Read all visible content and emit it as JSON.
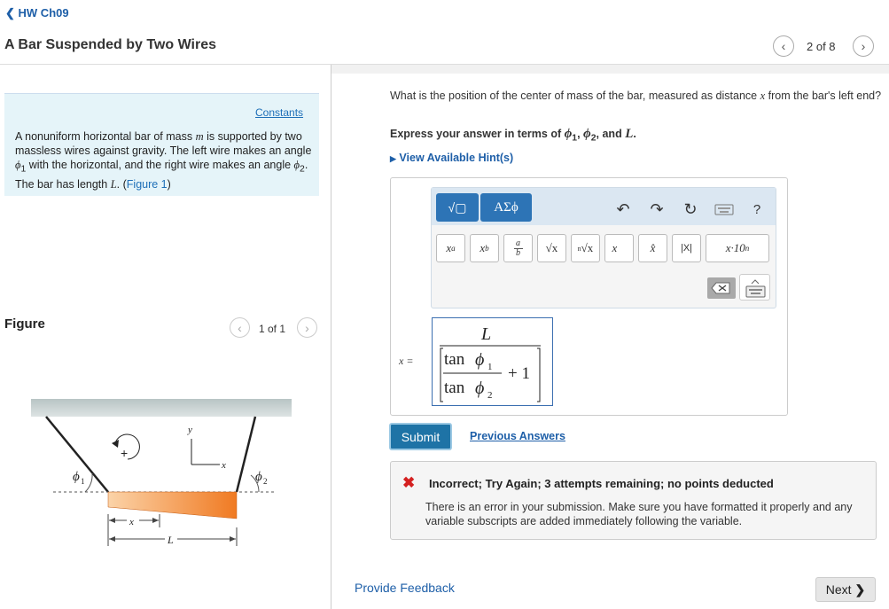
{
  "header": {
    "back_label": "HW Ch09",
    "title": "A Bar Suspended by Two Wires",
    "part_counter": "2 of 8"
  },
  "problem": {
    "constants_label": "Constants",
    "text_1": "A nonuniform horizontal bar of mass ",
    "var_m": "m",
    "text_2": " is supported by two massless wires against gravity. The left wire makes an angle ",
    "var_phi1": "ϕ",
    "sub_1": "1",
    "text_3": " with the horizontal, and the right wire makes an angle ",
    "var_phi2": "ϕ",
    "sub_2": "2",
    "text_4": ". The bar has length ",
    "var_L": "L",
    "text_5": ". (",
    "figure_link": "Figure 1",
    "text_6": ")"
  },
  "figure": {
    "heading": "Figure",
    "counter": "1 of 1",
    "labels": {
      "y": "y",
      "x_axis": "x",
      "phi1": "ϕ",
      "phi1_sub": "1",
      "phi2": "ϕ",
      "phi2_sub": "2",
      "x_dim": "x",
      "L_dim": "L",
      "rotation_sign": "+"
    }
  },
  "question": {
    "text_1": "What is the position of the center of mass of the bar, measured as distance ",
    "var_x": "x",
    "text_2": " from the bar's left end?",
    "instruction_1": "Express your answer in terms of ",
    "instruction_phi": "ϕ",
    "instruction_sub1": "1",
    "instruction_sep": ", ",
    "instruction_sub2": "2",
    "instruction_and": ", and ",
    "instruction_L": "L",
    "instruction_end": ".",
    "hints_label": "View Available Hint(s)"
  },
  "toolbar": {
    "templates_label": "√▢",
    "greek_label": "ΑΣϕ",
    "help_label": "?",
    "buttons": [
      {
        "name": "superscript-button",
        "label": "x",
        "sup": "a"
      },
      {
        "name": "subscript-button",
        "label": "x",
        "sub": "b"
      },
      {
        "name": "fraction-button",
        "num": "a",
        "den": "b"
      },
      {
        "name": "sqrt-button",
        "label": "√x"
      },
      {
        "name": "nth-root-button",
        "index": "n",
        "label": "√x"
      },
      {
        "name": "vector-button",
        "label": "x⃗"
      },
      {
        "name": "unit-vector-button",
        "label": "x̂"
      },
      {
        "name": "abs-button",
        "label": "|X|"
      },
      {
        "name": "scientific-button",
        "label": "x·10",
        "sup": "n"
      }
    ]
  },
  "answer": {
    "label": "x =",
    "numerator": "L",
    "tan_1": "tan",
    "phi_1": "ϕ",
    "sub_1": "1",
    "tan_2": "tan",
    "phi_2": "ϕ",
    "sub_2": "2",
    "plus_one": "+ 1"
  },
  "actions": {
    "submit_label": "Submit",
    "previous_answers_label": "Previous Answers"
  },
  "feedback": {
    "icon": "✖",
    "title": "Incorrect; Try Again; 3 attempts remaining; no points deducted",
    "body": "There is an error in your submission. Make sure you have formatted it properly and any variable subscripts are added immediately following the variable."
  },
  "footer": {
    "provide_feedback_label": "Provide Feedback",
    "next_label": "Next"
  },
  "colors": {
    "accent": "#2d74b6",
    "problem_bg": "#e5f4f9",
    "error": "#d42020",
    "bar_orange": "#f07a22"
  }
}
